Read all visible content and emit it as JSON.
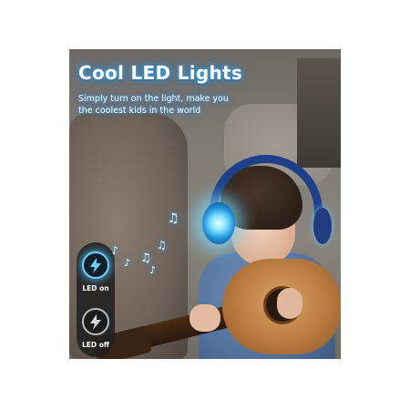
{
  "headline": {
    "title": "Cool LED Lights",
    "subtitle_line1": "Simply turn on the light, make you",
    "subtitle_line2": "the coolest kids in the world"
  },
  "led_control": {
    "on_label": "LED on",
    "off_label": "LED off",
    "on_icon": "lightning-bolt-icon",
    "off_icon": "lightning-bolt-icon"
  },
  "decorations": {
    "note_icon": "music-note-icon"
  },
  "colors": {
    "glow_blue": "#3ab6ff",
    "headphone_navy": "#1f3f8a",
    "pill_background": "#202020"
  }
}
